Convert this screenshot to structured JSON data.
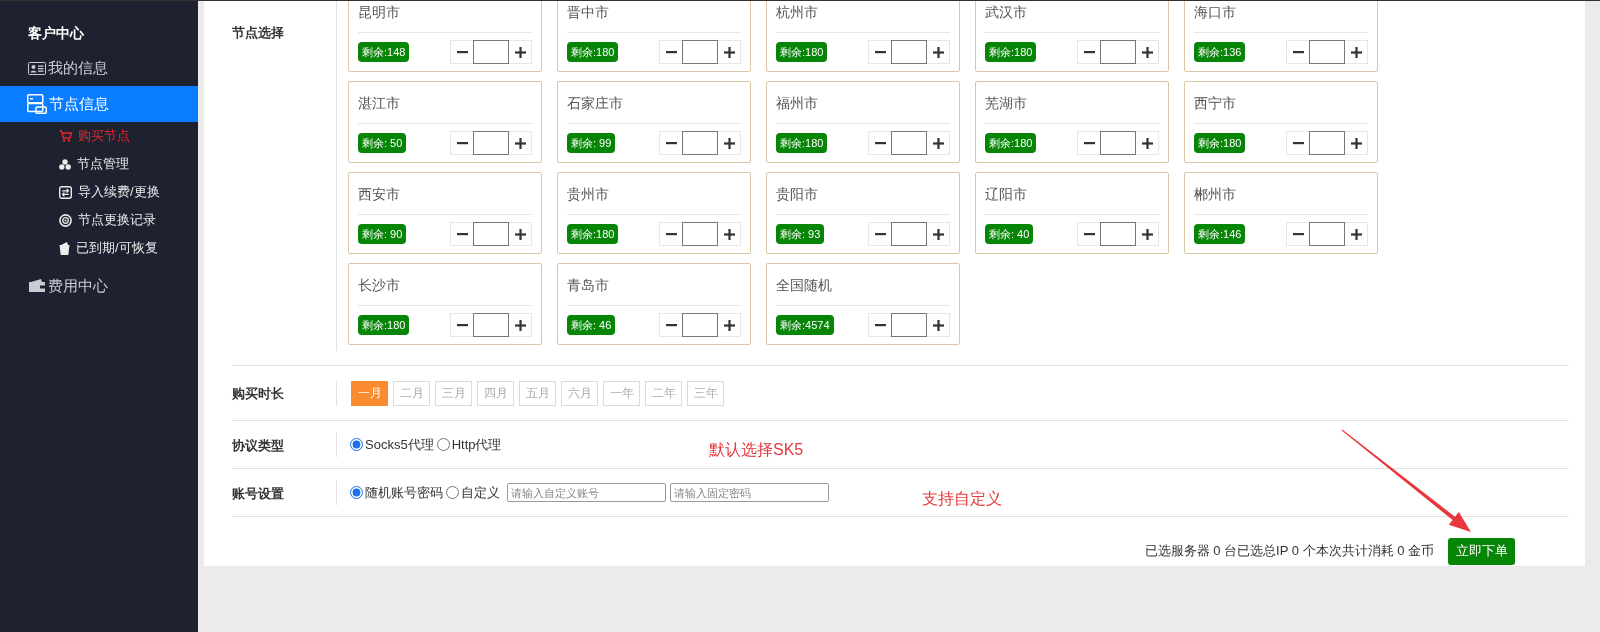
{
  "sidebar": {
    "title": "客户中心",
    "items": [
      {
        "label": "我的信息",
        "selected": false
      },
      {
        "label": "节点信息",
        "selected": true,
        "children": [
          {
            "label": "购买节点",
            "selected": true
          },
          {
            "label": "节点管理",
            "selected": false
          },
          {
            "label": "导入续费/更换",
            "selected": false
          },
          {
            "label": "节点更换记录",
            "selected": false
          },
          {
            "label": "已到期/可恢复",
            "selected": false
          }
        ]
      },
      {
        "label": "费用中心",
        "selected": false
      }
    ]
  },
  "node_selection": {
    "label": "节点选择",
    "nodes": [
      {
        "city": "昆明市",
        "remaining": "剩余:148"
      },
      {
        "city": "晋中市",
        "remaining": "剩余:180"
      },
      {
        "city": "杭州市",
        "remaining": "剩余:180"
      },
      {
        "city": "武汉市",
        "remaining": "剩余:180"
      },
      {
        "city": "海口市",
        "remaining": "剩余:136"
      },
      {
        "city": "湛江市",
        "remaining": "剩余: 50"
      },
      {
        "city": "石家庄市",
        "remaining": "剩余: 99"
      },
      {
        "city": "福州市",
        "remaining": "剩余:180"
      },
      {
        "city": "芜湖市",
        "remaining": "剩余:180"
      },
      {
        "city": "西宁市",
        "remaining": "剩余:180"
      },
      {
        "city": "西安市",
        "remaining": "剩余: 90"
      },
      {
        "city": "贵州市",
        "remaining": "剩余:180"
      },
      {
        "city": "贵阳市",
        "remaining": "剩余: 93"
      },
      {
        "city": "辽阳市",
        "remaining": "剩余: 40"
      },
      {
        "city": "郴州市",
        "remaining": "剩余:146"
      },
      {
        "city": "长沙市",
        "remaining": "剩余:180"
      },
      {
        "city": "青岛市",
        "remaining": "剩余: 46"
      },
      {
        "city": "全国随机",
        "remaining": "剩余:4574"
      }
    ]
  },
  "duration": {
    "label": "购买时长",
    "options": [
      {
        "label": "一月",
        "selected": true
      },
      {
        "label": "二月",
        "selected": false
      },
      {
        "label": "三月",
        "selected": false
      },
      {
        "label": "四月",
        "selected": false
      },
      {
        "label": "五月",
        "selected": false
      },
      {
        "label": "六月",
        "selected": false
      },
      {
        "label": "一年",
        "selected": false
      },
      {
        "label": "二年",
        "selected": false
      },
      {
        "label": "三年",
        "selected": false
      }
    ]
  },
  "protocol": {
    "label": "协议类型",
    "options": [
      {
        "label": "Socks5代理",
        "selected": true
      },
      {
        "label": "Http代理",
        "selected": false
      }
    ],
    "note": "默认选择SK5"
  },
  "account": {
    "label": "账号设置",
    "options": [
      {
        "label": "随机账号密码",
        "selected": true
      },
      {
        "label": "自定义",
        "selected": false
      }
    ],
    "fields": [
      {
        "placeholder": "请输入自定义账号"
      },
      {
        "placeholder": "请输入固定密码"
      }
    ],
    "note": "支持自定义"
  },
  "order": {
    "summary": "已选服务器 0 台已选总IP 0 个本次共计消耗 0 金币",
    "button": "立即下单"
  }
}
